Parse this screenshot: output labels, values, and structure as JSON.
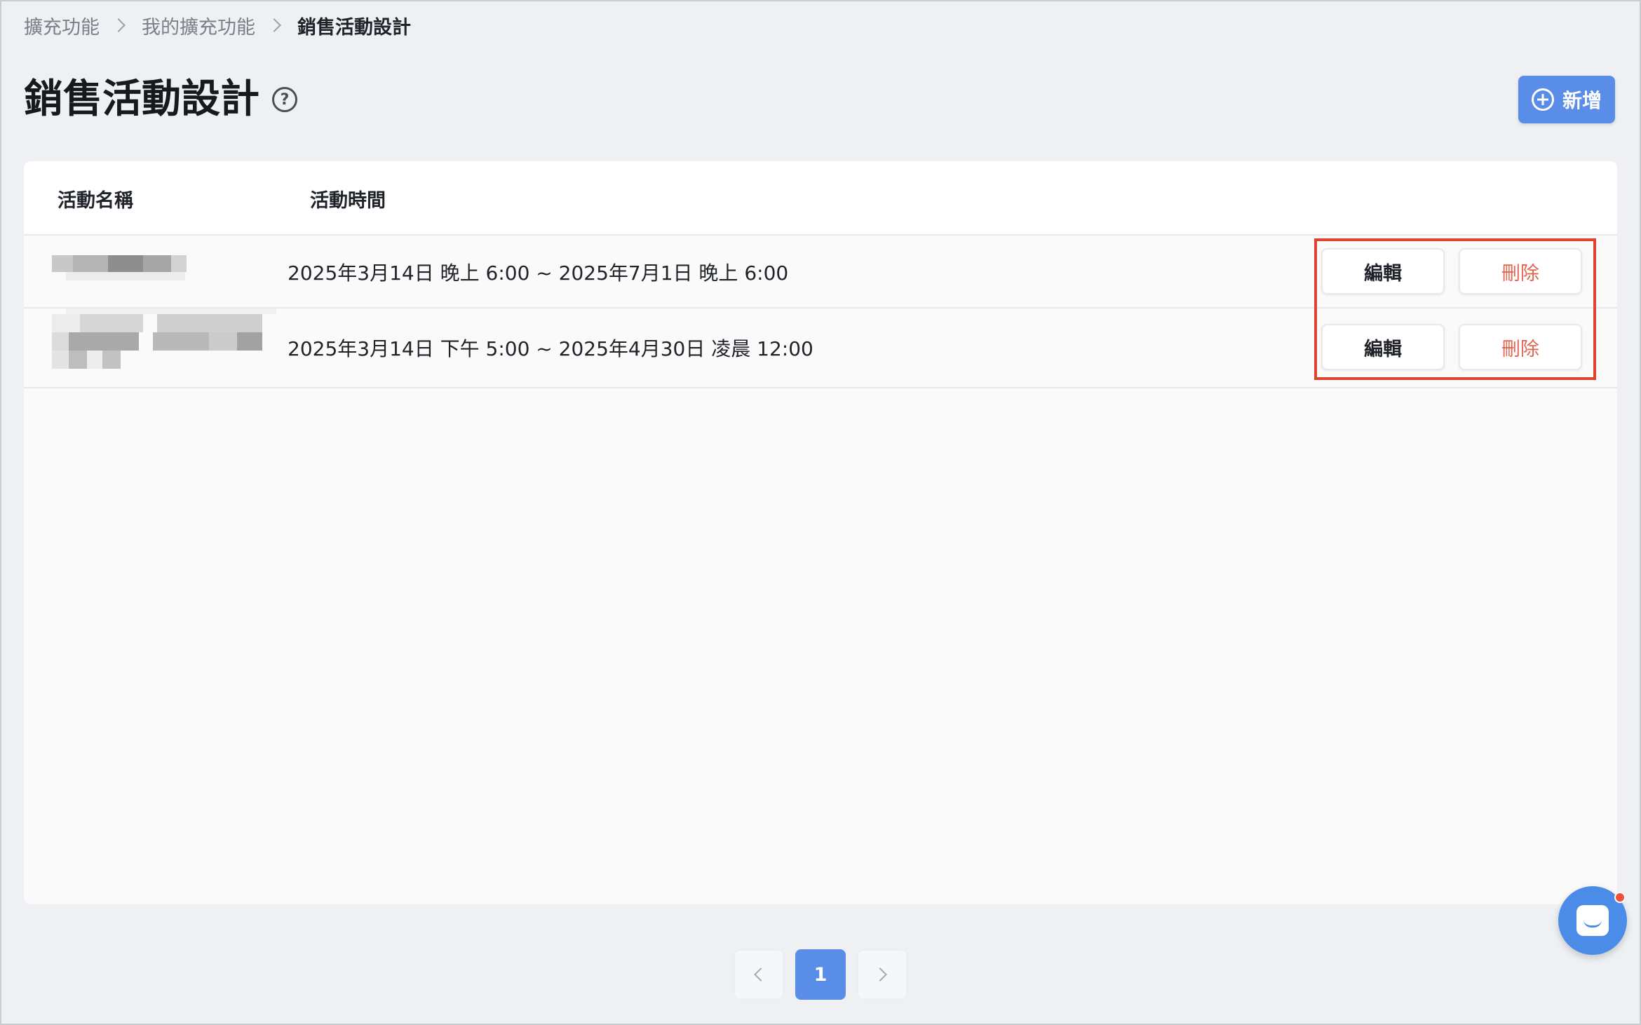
{
  "breadcrumb": [
    "擴充功能",
    "我的擴充功能",
    "銷售活動設計"
  ],
  "page_title": "銷售活動設計",
  "help_icon": "?",
  "add_button": {
    "label": "新增",
    "icon": "plus-circle-icon"
  },
  "table": {
    "columns": [
      "活動名稱",
      "活動時間"
    ],
    "rows": [
      {
        "time": "2025年3月14日 晚上 6:00 ~ 2025年7月1日 晚上 6:00",
        "edit": "編輯",
        "delete": "刪除"
      },
      {
        "time": "2025年3月14日 下午 5:00 ~ 2025年4月30日 凌晨 12:00",
        "edit": "編輯",
        "delete": "刪除"
      }
    ]
  },
  "pagination": {
    "current": "1"
  },
  "colors": {
    "primary": "#5a8de8",
    "danger": "#e0664f",
    "highlight": "#e0432f"
  }
}
